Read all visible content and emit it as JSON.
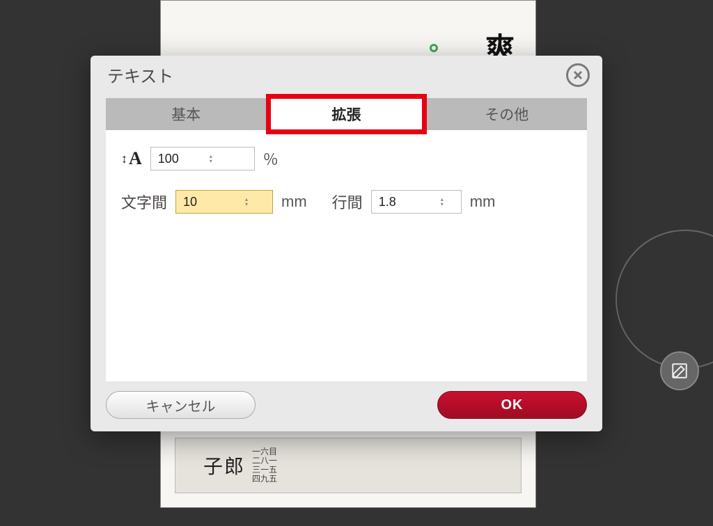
{
  "dialog": {
    "title": "テキスト",
    "tabs": [
      {
        "label": "基本",
        "active": false
      },
      {
        "label": "拡張",
        "active": true
      },
      {
        "label": "その他",
        "active": false
      }
    ],
    "highlightTabIndex": 1,
    "scale": {
      "value": "100",
      "unit": "％"
    },
    "charSpacing": {
      "label": "文字間",
      "value": "10",
      "unit": "mm",
      "focused": true
    },
    "lineSpacing": {
      "label": "行間",
      "value": "1.8",
      "unit": "mm"
    },
    "buttons": {
      "cancel": "キャンセル",
      "ok": "OK"
    }
  },
  "background": {
    "nameText": "子郎",
    "addressColumns": "一六目\n二八一\n三一五\n四九五"
  }
}
